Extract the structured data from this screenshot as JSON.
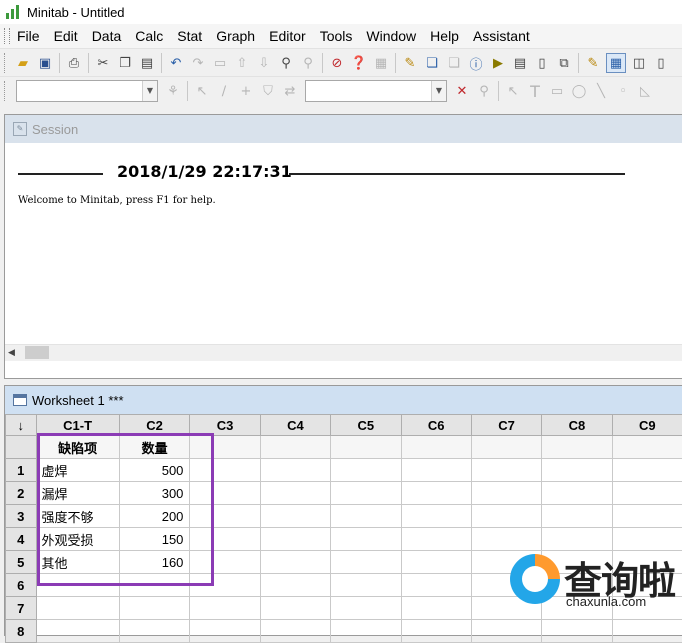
{
  "window": {
    "title": "Minitab - Untitled"
  },
  "menu": [
    "File",
    "Edit",
    "Data",
    "Calc",
    "Stat",
    "Graph",
    "Editor",
    "Tools",
    "Window",
    "Help",
    "Assistant"
  ],
  "toolbar1_icons": [
    "open-icon",
    "save-icon",
    "print-icon",
    "cut-icon",
    "copy-icon",
    "paste-icon",
    "undo-icon",
    "redo-icon",
    "blank-icon",
    "up-arrow-icon",
    "down-arrow-icon",
    "find-icon",
    "replace-icon",
    "cancel-icon",
    "help-icon",
    "notes-icon",
    "graph-icon",
    "stack-icon",
    "layout-icon",
    "info-icon",
    "run-icon",
    "report-icon",
    "new-doc-icon",
    "tile-icon",
    "session-icon",
    "worksheet-icon",
    "project-icon",
    "more-icon"
  ],
  "toolbar2_icons": [
    "brush-icon",
    "pointer-icon",
    "pen-icon",
    "crosshair-icon",
    "filter-icon",
    "swap-icon",
    "delete-icon",
    "zoom-icon",
    "select-icon",
    "text-icon",
    "rectangle-icon",
    "ellipse-icon",
    "line-icon",
    "dot-icon",
    "polygon-icon"
  ],
  "session": {
    "title": "Session",
    "timestamp": "2018/1/29 22:17:31",
    "welcome": "Welcome to Minitab, press F1 for help."
  },
  "worksheet": {
    "title": "Worksheet 1 ***",
    "corner": "↓",
    "columns": [
      "C1-T",
      "C2",
      "C3",
      "C4",
      "C5",
      "C6",
      "C7",
      "C8",
      "C9"
    ],
    "names": [
      "缺陷项",
      "数量",
      "",
      "",
      "",
      "",
      "",
      "",
      ""
    ],
    "rows": [
      {
        "n": "1",
        "c1": "虚焊",
        "c2": "500"
      },
      {
        "n": "2",
        "c1": "漏焊",
        "c2": "300"
      },
      {
        "n": "3",
        "c1": "强度不够",
        "c2": "200"
      },
      {
        "n": "4",
        "c1": "外观受损",
        "c2": "150"
      },
      {
        "n": "5",
        "c1": "其他",
        "c2": "160"
      },
      {
        "n": "6",
        "c1": "",
        "c2": ""
      },
      {
        "n": "7",
        "c1": "",
        "c2": ""
      },
      {
        "n": "8",
        "c1": "",
        "c2": ""
      }
    ]
  },
  "watermark": {
    "title": "查询啦",
    "url": "chaxunla.com"
  }
}
